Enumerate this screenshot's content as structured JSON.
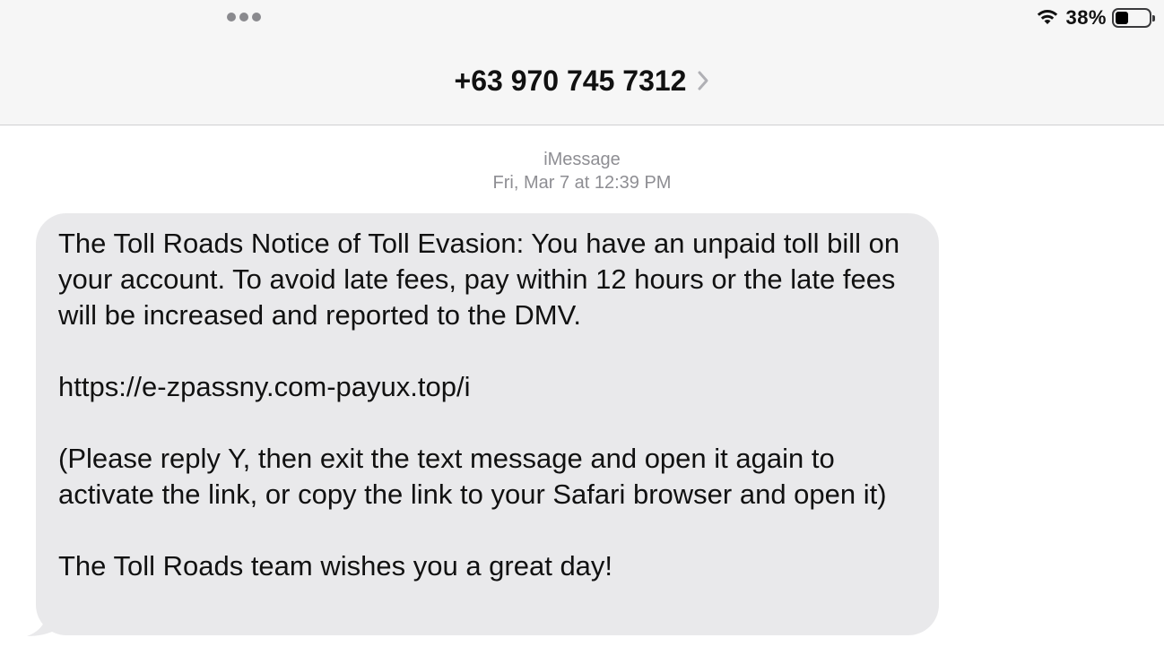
{
  "status_bar": {
    "battery_percent": "38%",
    "battery_level": 0.38,
    "wifi_icon": "wifi-icon",
    "battery_icon": "battery-icon"
  },
  "header": {
    "contact": "+63 970 745 7312",
    "chevron_icon": "chevron-right-icon"
  },
  "conversation": {
    "service": "iMessage",
    "timestamp": "Fri, Mar 7 at 12:39 PM"
  },
  "message": {
    "paragraphs": [
      "The Toll Roads Notice of Toll Evasion: You have an unpaid toll bill on your account. To avoid late fees, pay within 12 hours or the late fees will be increased and reported to the DMV.",
      "https://e-zpassny.com-payux.top/i",
      "(Please reply Y, then exit the text message and open it again to activate the link, or copy the link to your Safari browser and open it)",
      "The Toll Roads team wishes you a great day!"
    ]
  },
  "colors": {
    "header_bg": "#f6f6f6",
    "bubble_bg": "#e9e9eb",
    "meta_text": "#8e8e93"
  }
}
